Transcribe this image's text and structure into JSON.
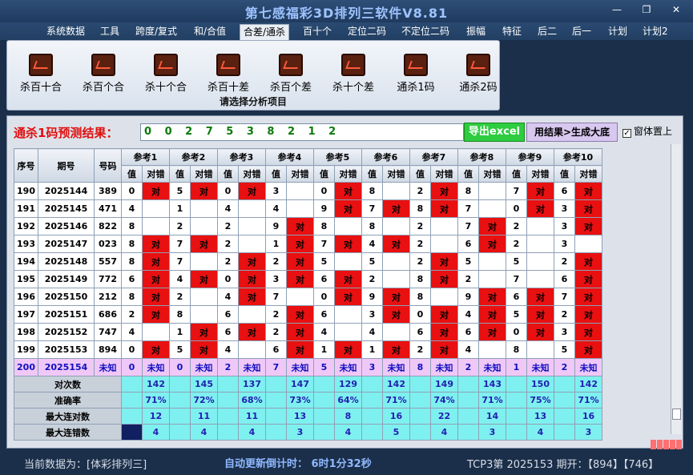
{
  "window": {
    "title": "第七感福彩3D排列三软件V8.81",
    "min": "—",
    "restore": "❐",
    "close": "✕"
  },
  "menu": [
    "系统数据",
    "工具",
    "跨度/复式",
    "和/合值",
    "合差/通杀",
    "百十个",
    "定位二码",
    "不定位二码",
    "振幅",
    "特征",
    "后二",
    "后一",
    "计划",
    "计划2"
  ],
  "active_menu": 4,
  "ribbon": {
    "buttons": [
      "杀百十合",
      "杀百个合",
      "杀十个合",
      "杀百十差",
      "杀百个差",
      "杀十个差",
      "通杀1码",
      "通杀2码"
    ],
    "caption": "请选择分析项目",
    "icon": "chart-icon"
  },
  "prediction": {
    "label": "通杀1码预测结果：",
    "value": "0 0 2 7 5 3 8 2 1 2"
  },
  "buttons": {
    "excel": "导出excel",
    "generate": "用结果>生成大底",
    "on_top": "窗体置上",
    "on_top_checked": "✓"
  },
  "table": {
    "headers": {
      "idx": "序号",
      "period": "期号",
      "num": "号码",
      "refs": [
        "参考1",
        "参考2",
        "参考3",
        "参考4",
        "参考5",
        "参考6",
        "参考7",
        "参考8",
        "参考9",
        "参考10"
      ],
      "value": "值",
      "check": "对错"
    },
    "hit_text": "对",
    "rows": [
      {
        "idx": "190",
        "period": "2025144",
        "num": "389",
        "vals": [
          "0",
          "5",
          "0",
          "3",
          "0",
          "8",
          "2",
          "8",
          "7",
          "6"
        ],
        "hits": [
          1,
          1,
          1,
          0,
          1,
          0,
          1,
          0,
          1,
          1
        ],
        "red": [
          0,
          0,
          0,
          1,
          0,
          1,
          0,
          1,
          0,
          0
        ]
      },
      {
        "idx": "191",
        "period": "2025145",
        "num": "471",
        "vals": [
          "4",
          "1",
          "4",
          "4",
          "9",
          "7",
          "8",
          "7",
          "0",
          "3"
        ],
        "hits": [
          0,
          0,
          0,
          0,
          1,
          1,
          1,
          0,
          1,
          1
        ],
        "red": [
          1,
          1,
          1,
          1,
          0,
          1,
          0,
          1,
          0,
          0
        ]
      },
      {
        "idx": "192",
        "period": "2025146",
        "num": "822",
        "vals": [
          "8",
          "2",
          "2",
          "9",
          "8",
          "8",
          "2",
          "7",
          "2",
          "3"
        ],
        "hits": [
          0,
          0,
          0,
          1,
          0,
          0,
          0,
          1,
          0,
          1
        ],
        "red": [
          1,
          1,
          1,
          0,
          1,
          1,
          1,
          0,
          1,
          0
        ]
      },
      {
        "idx": "193",
        "period": "2025147",
        "num": "023",
        "vals": [
          "8",
          "7",
          "2",
          "1",
          "7",
          "4",
          "2",
          "6",
          "2",
          "3"
        ],
        "hits": [
          1,
          1,
          0,
          1,
          1,
          1,
          0,
          1,
          0,
          0
        ],
        "red": [
          0,
          0,
          1,
          0,
          0,
          0,
          1,
          0,
          1,
          1
        ]
      },
      {
        "idx": "194",
        "period": "2025148",
        "num": "557",
        "vals": [
          "8",
          "7",
          "2",
          "2",
          "5",
          "5",
          "2",
          "5",
          "5",
          "2"
        ],
        "hits": [
          1,
          0,
          1,
          1,
          0,
          0,
          1,
          0,
          0,
          1
        ],
        "red": [
          0,
          1,
          0,
          0,
          1,
          1,
          0,
          1,
          1,
          0
        ]
      },
      {
        "idx": "195",
        "period": "2025149",
        "num": "772",
        "vals": [
          "6",
          "4",
          "0",
          "3",
          "6",
          "2",
          "8",
          "2",
          "7",
          "6"
        ],
        "hits": [
          1,
          1,
          1,
          1,
          1,
          0,
          1,
          0,
          0,
          1
        ],
        "red": [
          0,
          0,
          0,
          0,
          0,
          1,
          0,
          1,
          1,
          0
        ]
      },
      {
        "idx": "196",
        "period": "2025150",
        "num": "212",
        "vals": [
          "8",
          "2",
          "4",
          "7",
          "0",
          "9",
          "8",
          "9",
          "6",
          "7"
        ],
        "hits": [
          1,
          0,
          1,
          0,
          1,
          1,
          0,
          1,
          1,
          1
        ],
        "red": [
          0,
          1,
          0,
          0,
          0,
          0,
          1,
          0,
          0,
          0
        ]
      },
      {
        "idx": "197",
        "period": "2025151",
        "num": "686",
        "vals": [
          "2",
          "8",
          "6",
          "2",
          "6",
          "3",
          "0",
          "4",
          "5",
          "2"
        ],
        "hits": [
          1,
          0,
          0,
          1,
          0,
          1,
          1,
          1,
          1,
          1
        ],
        "red": [
          0,
          1,
          1,
          0,
          1,
          0,
          0,
          0,
          0,
          0
        ]
      },
      {
        "idx": "198",
        "period": "2025152",
        "num": "747",
        "vals": [
          "4",
          "1",
          "6",
          "2",
          "4",
          "4",
          "6",
          "6",
          "0",
          "3"
        ],
        "hits": [
          0,
          1,
          1,
          1,
          0,
          0,
          1,
          1,
          1,
          1
        ],
        "red": [
          1,
          0,
          0,
          0,
          1,
          1,
          0,
          0,
          0,
          0
        ]
      },
      {
        "idx": "199",
        "period": "2025153",
        "num": "894",
        "vals": [
          "0",
          "5",
          "4",
          "6",
          "1",
          "1",
          "2",
          "4",
          "8",
          "5"
        ],
        "hits": [
          1,
          1,
          0,
          1,
          1,
          1,
          1,
          0,
          0,
          1
        ],
        "red": [
          0,
          0,
          1,
          0,
          0,
          0,
          0,
          1,
          1,
          0
        ]
      }
    ],
    "current": {
      "idx": "200",
      "period": "2025154",
      "num": "未知",
      "vals": [
        "0",
        "0",
        "2",
        "7",
        "5",
        "3",
        "8",
        "2",
        "1",
        "2"
      ],
      "check": "未知"
    },
    "stats": [
      {
        "label": "对次数",
        "vals": [
          "142",
          "145",
          "137",
          "147",
          "129",
          "142",
          "149",
          "143",
          "150",
          "142"
        ]
      },
      {
        "label": "准确率",
        "vals": [
          "71%",
          "72%",
          "68%",
          "73%",
          "64%",
          "71%",
          "74%",
          "71%",
          "75%",
          "71%"
        ]
      },
      {
        "label": "最大连对数",
        "vals": [
          "12",
          "11",
          "11",
          "13",
          "8",
          "16",
          "22",
          "14",
          "13",
          "16"
        ]
      },
      {
        "label": "最大连错数",
        "vals": [
          "4",
          "4",
          "4",
          "3",
          "4",
          "5",
          "4",
          "3",
          "4",
          "3"
        ]
      }
    ]
  },
  "status": {
    "left": "当前数据为：[体彩排列三]",
    "mid": "自动更新倒计时：  6时1分32秒",
    "right": "TCP3第 2025153 期开：【894】【746】"
  }
}
